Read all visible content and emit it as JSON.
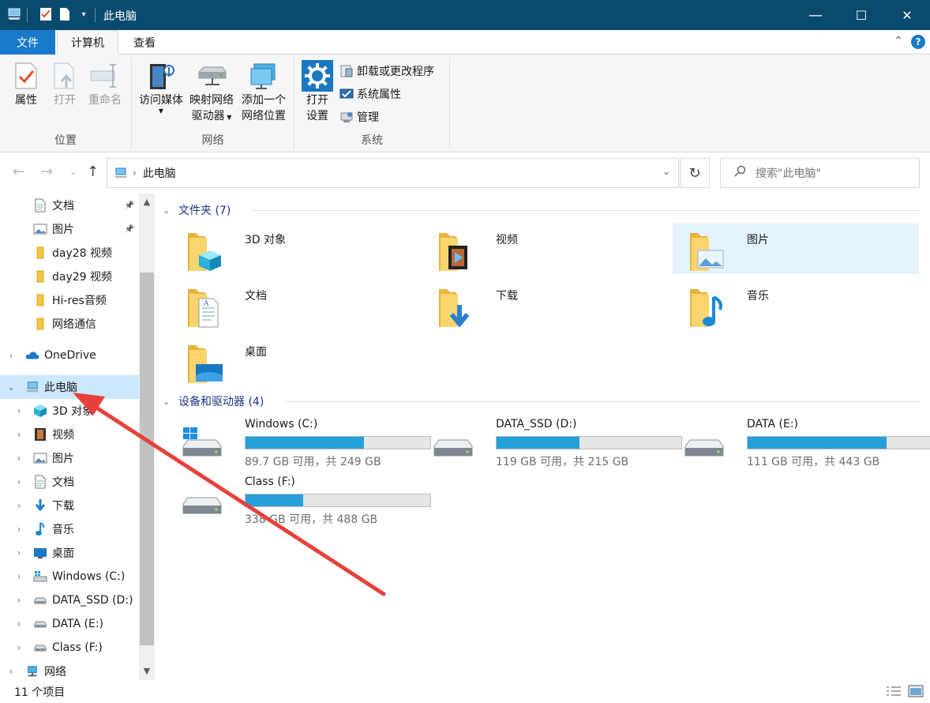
{
  "window": {
    "title": "此电脑",
    "minimize_glyph": "—",
    "maximize_glyph": "☐",
    "close_glyph": "✕"
  },
  "ribbon_tabs": {
    "file": "文件",
    "computer": "计算机",
    "view": "查看"
  },
  "ribbon": {
    "location": {
      "label": "位置",
      "properties": "属性",
      "open": "打开",
      "rename": "重命名"
    },
    "network": {
      "label": "网络",
      "media_line1": "访问媒体",
      "map_line1": "映射网络",
      "map_line2": "驱动器",
      "add_line1": "添加一个",
      "add_line2": "网络位置"
    },
    "system": {
      "label": "系统",
      "open_settings_line1": "打开",
      "open_settings_line2": "设置",
      "uninstall": "卸载或更改程序",
      "system_properties": "系统属性",
      "manage": "管理"
    }
  },
  "address": {
    "crumb": "此电脑",
    "search_placeholder": "搜索\"此电脑\""
  },
  "sidebar": {
    "quick": [
      {
        "label": "文档",
        "icon": "document-icon",
        "pinned": true
      },
      {
        "label": "图片",
        "icon": "picture-icon",
        "pinned": true
      },
      {
        "label": "day28 视频",
        "icon": "folder-icon",
        "pinned": false
      },
      {
        "label": "day29 视频",
        "icon": "folder-icon",
        "pinned": false
      },
      {
        "label": "Hi-res音频",
        "icon": "folder-icon",
        "pinned": false
      },
      {
        "label": "网络通信",
        "icon": "folder-icon",
        "pinned": false
      }
    ],
    "onedrive": "OneDrive",
    "thispc": "此电脑",
    "pc_children": [
      {
        "label": "3D 对象",
        "icon": "3d-objects-icon"
      },
      {
        "label": "视频",
        "icon": "video-icon"
      },
      {
        "label": "图片",
        "icon": "picture-icon"
      },
      {
        "label": "文档",
        "icon": "document-icon"
      },
      {
        "label": "下载",
        "icon": "download-icon"
      },
      {
        "label": "音乐",
        "icon": "music-icon"
      },
      {
        "label": "桌面",
        "icon": "desktop-icon"
      },
      {
        "label": "Windows (C:)",
        "icon": "windows-drive-icon"
      },
      {
        "label": "DATA_SSD (D:)",
        "icon": "drive-icon"
      },
      {
        "label": "DATA (E:)",
        "icon": "drive-icon"
      },
      {
        "label": "Class (F:)",
        "icon": "drive-icon"
      }
    ],
    "network": "网络"
  },
  "content": {
    "folders_header": "文件夹 (7)",
    "folders": [
      {
        "name": "3D 对象",
        "icon": "3d-objects-folder-icon"
      },
      {
        "name": "视频",
        "icon": "video-folder-icon"
      },
      {
        "name": "图片",
        "icon": "picture-folder-icon"
      },
      {
        "name": "文档",
        "icon": "document-folder-icon"
      },
      {
        "name": "下载",
        "icon": "download-folder-icon"
      },
      {
        "name": "音乐",
        "icon": "music-folder-icon"
      },
      {
        "name": "桌面",
        "icon": "desktop-folder-icon"
      }
    ],
    "drives_header": "设备和驱动器 (4)",
    "drives": [
      {
        "name": "Windows (C:)",
        "free": "89.7 GB 可用，共 249 GB",
        "used_fraction": 0.64,
        "icon": "windows-drive-icon"
      },
      {
        "name": "DATA_SSD (D:)",
        "free": "119 GB 可用，共 215 GB",
        "used_fraction": 0.45,
        "icon": "drive-icon"
      },
      {
        "name": "DATA (E:)",
        "free": "111 GB 可用，共 443 GB",
        "used_fraction": 0.75,
        "icon": "drive-icon"
      },
      {
        "name": "Class (F:)",
        "free": "338 GB 可用，共 488 GB",
        "used_fraction": 0.31,
        "icon": "drive-icon"
      }
    ]
  },
  "status": {
    "item_count": "11 个项目"
  },
  "colors": {
    "titlebar": "#0b4a6f",
    "file_tab": "#1979ca",
    "selection": "#cce8ff",
    "drive_fill": "#26a0da",
    "annotation_arrow": "#e8413b"
  }
}
